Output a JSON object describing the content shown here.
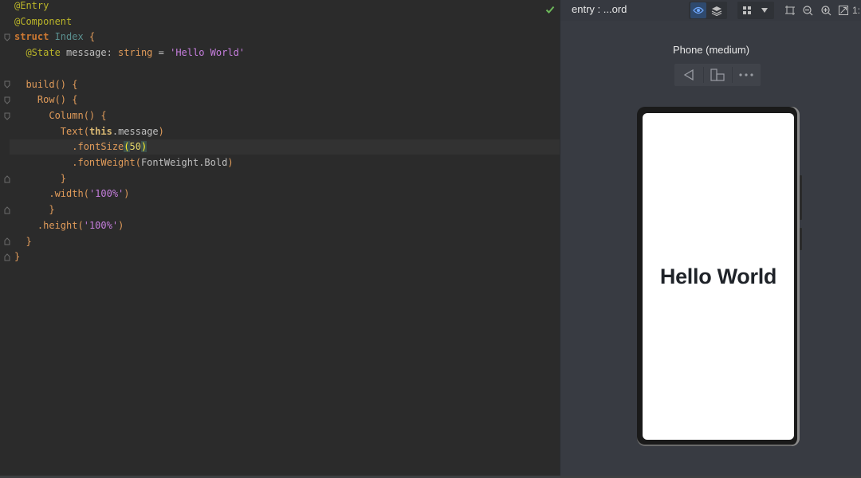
{
  "editor": {
    "lines": [
      [
        {
          "t": "@Entry",
          "c": "ann"
        }
      ],
      [
        {
          "t": "@Component",
          "c": "ann"
        }
      ],
      [
        {
          "t": "struct ",
          "c": "kw"
        },
        {
          "t": "Index",
          "c": "tn"
        },
        {
          "t": " {",
          "c": "fn"
        }
      ],
      [
        {
          "t": "  @State",
          "c": "ann"
        },
        {
          "t": " message",
          "c": "pl"
        },
        {
          "t": ": ",
          "c": "pl"
        },
        {
          "t": "string",
          "c": "fn"
        },
        {
          "t": " = ",
          "c": "pl"
        },
        {
          "t": "'Hello World'",
          "c": "str"
        }
      ],
      [],
      [
        {
          "t": "  build",
          "c": "fn"
        },
        {
          "t": "() {",
          "c": "fn"
        }
      ],
      [
        {
          "t": "    Row",
          "c": "fn"
        },
        {
          "t": "() {",
          "c": "fn"
        }
      ],
      [
        {
          "t": "      Column",
          "c": "fn"
        },
        {
          "t": "() {",
          "c": "fn"
        }
      ],
      [
        {
          "t": "        Text",
          "c": "fn"
        },
        {
          "t": "(",
          "c": "fn"
        },
        {
          "t": "this",
          "c": "this"
        },
        {
          "t": ".message",
          "c": "pl"
        },
        {
          "t": ")",
          "c": "fn"
        }
      ],
      [
        {
          "t": "          .fontSize",
          "c": "fn"
        },
        {
          "t": "(",
          "c": "paren-hl"
        },
        {
          "t": "50",
          "c": "num"
        },
        {
          "t": ")",
          "c": "paren-hl"
        }
      ],
      [
        {
          "t": "          .fontWeight",
          "c": "fn"
        },
        {
          "t": "(",
          "c": "fn"
        },
        {
          "t": "FontWeight.Bold",
          "c": "pl"
        },
        {
          "t": ")",
          "c": "fn"
        }
      ],
      [
        {
          "t": "        }",
          "c": "fn"
        }
      ],
      [
        {
          "t": "      .width",
          "c": "fn"
        },
        {
          "t": "(",
          "c": "fn"
        },
        {
          "t": "'100%'",
          "c": "str"
        },
        {
          "t": ")",
          "c": "fn"
        }
      ],
      [
        {
          "t": "      }",
          "c": "fn"
        }
      ],
      [
        {
          "t": "    .height",
          "c": "fn"
        },
        {
          "t": "(",
          "c": "fn"
        },
        {
          "t": "'100%'",
          "c": "str"
        },
        {
          "t": ")",
          "c": "fn"
        }
      ],
      [
        {
          "t": "  }",
          "c": "fn"
        }
      ],
      [
        {
          "t": "}",
          "c": "fn"
        }
      ]
    ]
  },
  "preview": {
    "title": "entry : ...ord",
    "zoom_label": "1:",
    "device_label": "Phone (medium)",
    "screen_text": "Hello World"
  },
  "colors": {
    "editor_bg": "#2b2b2b",
    "preview_bg": "#383b42",
    "check": "#6db85a"
  }
}
